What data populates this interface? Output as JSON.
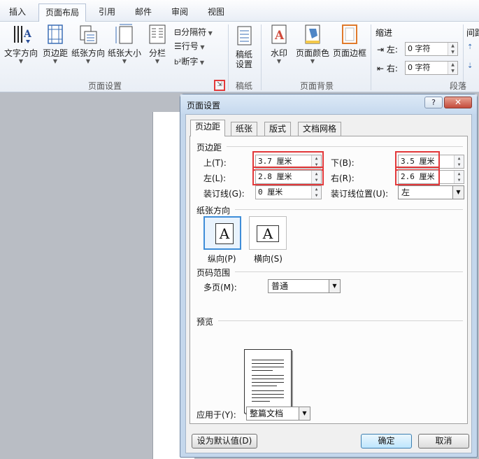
{
  "ribbon_tabs": [
    "插入",
    "页面布局",
    "引用",
    "邮件",
    "审阅",
    "视图"
  ],
  "ribbon": {
    "text_direction": "文字方向",
    "margins": "页边距",
    "orientation": "纸张方向",
    "size": "纸张大小",
    "columns": "分栏",
    "breaks": "分隔符",
    "line_numbers": "行号",
    "hyphenation": "断字",
    "manuscript": "稿纸\n设置",
    "watermark": "水印",
    "page_color": "页面颜色",
    "page_borders": "页面边框",
    "indent_title": "缩进",
    "indent_left_label": "左:",
    "indent_left_value": "0 字符",
    "indent_right_label": "右:",
    "indent_right_value": "0 字符",
    "spacing_title": "间距",
    "group_page_setup": "页面设置",
    "group_manuscript": "稿纸",
    "group_page_background": "页面背景",
    "group_paragraph": "段落"
  },
  "dialog": {
    "title": "页面设置",
    "help": "?",
    "close": "✕",
    "tabs": [
      "页边距",
      "纸张",
      "版式",
      "文档网格"
    ],
    "margins_section": "页边距",
    "top_label": "上(T):",
    "top_value": "3.7 厘米",
    "bottom_label": "下(B):",
    "bottom_value": "3.5 厘米",
    "left_label": "左(L):",
    "left_value": "2.8 厘米",
    "right_label": "右(R):",
    "right_value": "2.6 厘米",
    "gutter_label": "装订线(G):",
    "gutter_value": "0 厘米",
    "gutter_pos_label": "装订线位置(U):",
    "gutter_pos_value": "左",
    "orientation_section": "纸张方向",
    "portrait_label": "纵向(P)",
    "landscape_label": "横向(S)",
    "orient_glyph": "A",
    "pages_section": "页码范围",
    "multiple_pages_label": "多页(M):",
    "multiple_pages_value": "普通",
    "preview_section": "预览",
    "apply_to_label": "应用于(Y):",
    "apply_to_value": "整篇文档",
    "set_default": "设为默认值(D)",
    "ok": "确定",
    "cancel": "取消"
  },
  "colors": {
    "highlight": "#e2383a",
    "dialog_frame": "#c4d7ec",
    "selected_border": "#3e8dd8"
  }
}
